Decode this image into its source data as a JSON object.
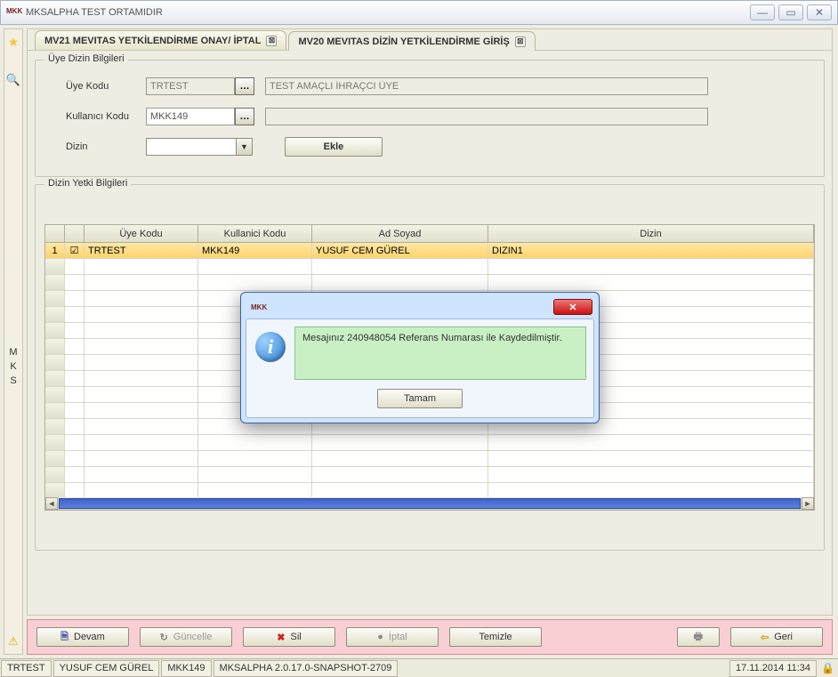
{
  "window": {
    "title": "MKSALPHA TEST ORTAMIDIR",
    "appicon": "MKK"
  },
  "tabs": [
    {
      "label": "MV21 MEVITAS YETKİLENDİRME ONAY/ İPTAL",
      "active": false
    },
    {
      "label": "MV20 MEVITAS DİZİN YETKİLENDİRME GİRİŞ",
      "active": true
    }
  ],
  "group1": {
    "legend": "Üye Dizin Bilgileri",
    "uyekodu_label": "Üye Kodu",
    "uyekodu_value": "TRTEST",
    "uyekodu_desc": "TEST AMAÇLI İHRAÇCI ÜYE",
    "kulkodu_label": "Kullanıcı Kodu",
    "kulkodu_value": "MKK149",
    "kulkodu_desc": "",
    "dizin_label": "Dizin",
    "ekle_label": "Ekle"
  },
  "group2": {
    "legend": "Dizin Yetki Bilgileri",
    "columns": [
      "",
      "",
      "Üye Kodu",
      "Kullanici Kodu",
      "Ad Soyad",
      "Dizin"
    ],
    "rows": [
      {
        "n": "1",
        "checked": true,
        "uye": "TRTEST",
        "kul": "MKK149",
        "ad": "YUSUF CEM GÜREL",
        "dizin": "DIZIN1"
      }
    ]
  },
  "buttons": {
    "devam": "Devam",
    "guncelle": "Güncelle",
    "sil": "Sil",
    "iptal": "İptal",
    "temizle": "Temizle",
    "geri": "Geri"
  },
  "status": {
    "uye": "TRTEST",
    "user": "YUSUF CEM GÜREL",
    "code": "MKK149",
    "version": "MKSALPHA 2.0.17.0-SNAPSHOT-2709",
    "datetime": "17.11.2014 11:34"
  },
  "dialog": {
    "appicon": "MKK",
    "message": "Mesajınız 240948054 Referans Numarası ile Kaydedilmiştir.",
    "ok": "Tamam"
  },
  "sidebar": {
    "letters": "M\nK\nS"
  }
}
